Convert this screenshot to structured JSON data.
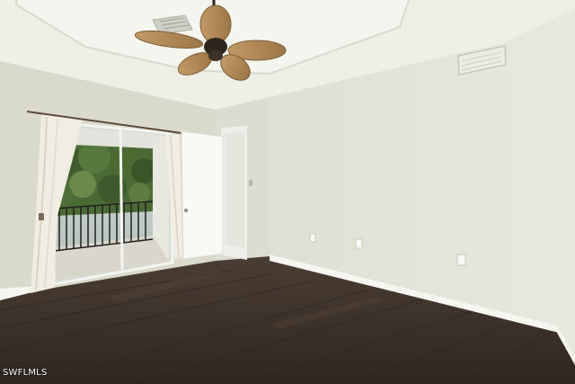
{
  "photo": {
    "subject": "empty-room-interior",
    "watermark": "SWFLMLS"
  },
  "colors": {
    "ceiling": "#f1f2ea",
    "wall_back": "#e0e1d5",
    "wall_left": "#dcdccf",
    "wall_right": "#e3e4d8",
    "floor": "#3c3129",
    "baseboard": "#f7f7f2",
    "fan_wood": "#b08a5a",
    "curtain": "#f3efe4",
    "door": "#f8f8f5",
    "foliage": "#3f5a2e"
  }
}
